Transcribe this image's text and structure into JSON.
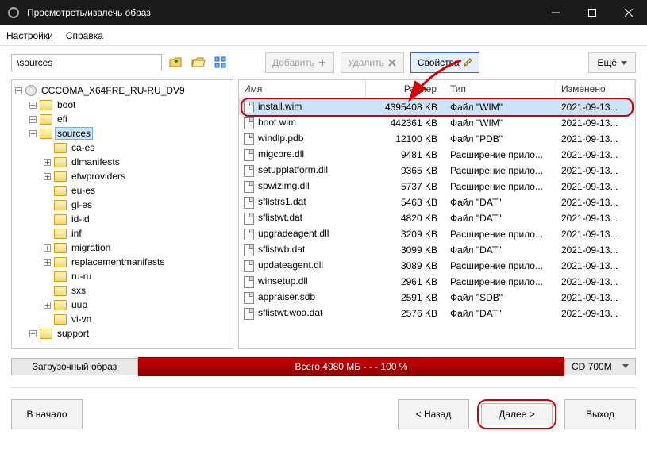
{
  "window": {
    "title": "Просмотреть/извлечь образ"
  },
  "menu": {
    "settings": "Настройки",
    "help": "Справка"
  },
  "toolbar": {
    "path": "\\sources",
    "add": "Добавить",
    "delete": "Удалить",
    "properties": "Свойства",
    "more": "Ещё"
  },
  "tree": {
    "root": "CCCOMA_X64FRE_RU-RU_DV9",
    "items": [
      {
        "label": "boot",
        "indent": 1,
        "twisty": "+",
        "icon": "folder"
      },
      {
        "label": "efi",
        "indent": 1,
        "twisty": "+",
        "icon": "folder"
      },
      {
        "label": "sources",
        "indent": 1,
        "twisty": "-",
        "icon": "folder-open",
        "selected": true
      },
      {
        "label": "ca-es",
        "indent": 2,
        "twisty": " ",
        "icon": "folder"
      },
      {
        "label": "dlmanifests",
        "indent": 2,
        "twisty": "+",
        "icon": "folder"
      },
      {
        "label": "etwproviders",
        "indent": 2,
        "twisty": "+",
        "icon": "folder"
      },
      {
        "label": "eu-es",
        "indent": 2,
        "twisty": " ",
        "icon": "folder"
      },
      {
        "label": "gl-es",
        "indent": 2,
        "twisty": " ",
        "icon": "folder"
      },
      {
        "label": "id-id",
        "indent": 2,
        "twisty": " ",
        "icon": "folder"
      },
      {
        "label": "inf",
        "indent": 2,
        "twisty": " ",
        "icon": "folder"
      },
      {
        "label": "migration",
        "indent": 2,
        "twisty": "+",
        "icon": "folder"
      },
      {
        "label": "replacementmanifests",
        "indent": 2,
        "twisty": "+",
        "icon": "folder"
      },
      {
        "label": "ru-ru",
        "indent": 2,
        "twisty": " ",
        "icon": "folder"
      },
      {
        "label": "sxs",
        "indent": 2,
        "twisty": " ",
        "icon": "folder"
      },
      {
        "label": "uup",
        "indent": 2,
        "twisty": "+",
        "icon": "folder"
      },
      {
        "label": "vi-vn",
        "indent": 2,
        "twisty": " ",
        "icon": "folder"
      },
      {
        "label": "support",
        "indent": 1,
        "twisty": "+",
        "icon": "folder"
      }
    ]
  },
  "list": {
    "cols": {
      "name": "Имя",
      "size": "Размер",
      "type": "Тип",
      "date": "Изменено"
    },
    "rows": [
      {
        "name": "install.wim",
        "size": "4395408 KB",
        "type": "Файл \"WIM\"",
        "date": "2021-09-13...",
        "selected": true
      },
      {
        "name": "boot.wim",
        "size": "442361 KB",
        "type": "Файл \"WIM\"",
        "date": "2021-09-13..."
      },
      {
        "name": "windlp.pdb",
        "size": "12100 KB",
        "type": "Файл \"PDB\"",
        "date": "2021-09-13..."
      },
      {
        "name": "migcore.dll",
        "size": "9481 KB",
        "type": "Расширение прило...",
        "date": "2021-09-13..."
      },
      {
        "name": "setupplatform.dll",
        "size": "9365 KB",
        "type": "Расширение прило...",
        "date": "2021-09-13..."
      },
      {
        "name": "spwizimg.dll",
        "size": "5737 KB",
        "type": "Расширение прило...",
        "date": "2021-09-13..."
      },
      {
        "name": "sflistrs1.dat",
        "size": "5463 KB",
        "type": "Файл \"DAT\"",
        "date": "2021-09-13..."
      },
      {
        "name": "sflistwt.dat",
        "size": "4820 KB",
        "type": "Файл \"DAT\"",
        "date": "2021-09-13..."
      },
      {
        "name": "upgradeagent.dll",
        "size": "3209 KB",
        "type": "Расширение прило...",
        "date": "2021-09-13..."
      },
      {
        "name": "sflistwb.dat",
        "size": "3099 KB",
        "type": "Файл \"DAT\"",
        "date": "2021-09-13..."
      },
      {
        "name": "updateagent.dll",
        "size": "3089 KB",
        "type": "Расширение прило...",
        "date": "2021-09-13..."
      },
      {
        "name": "winsetup.dll",
        "size": "2961 KB",
        "type": "Расширение прило...",
        "date": "2021-09-13..."
      },
      {
        "name": "appraiser.sdb",
        "size": "2591 KB",
        "type": "Файл \"SDB\"",
        "date": "2021-09-13..."
      },
      {
        "name": "sflistwt.woa.dat",
        "size": "2576 KB",
        "type": "Файл \"DAT\"",
        "date": "2021-09-13..."
      }
    ]
  },
  "status": {
    "boot_label": "Загрузочный образ",
    "total": "Всего  4980 МБ   - - -   100 %",
    "media": "CD 700M"
  },
  "footer": {
    "start": "В начало",
    "back": "< Назад",
    "next": "Далее >",
    "exit": "Выход"
  }
}
